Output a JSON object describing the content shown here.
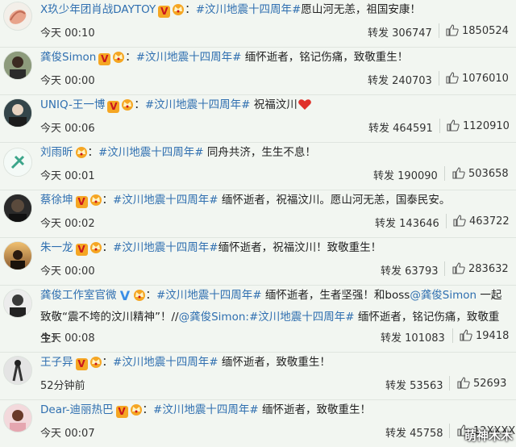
{
  "posts": [
    {
      "nick": "X玖少年团肖战DAYTOY",
      "badge": "V",
      "badge_type": "red",
      "crown": true,
      "sep": "：",
      "topic": "#汶川地震十四周年#",
      "text": "愿山河无恙，祖国安康！",
      "time": "今天 00:10",
      "repost_label": "转发",
      "reposts": "306747",
      "likes": "1850524",
      "avatar_icon": "avatar-shell-icon"
    },
    {
      "nick": "龚俊Simon",
      "badge": "V",
      "badge_type": "red",
      "crown": true,
      "sep": "：",
      "topic": "#汶川地震十四周年#",
      "text": " 缅怀逝者，铭记伤痛，致敬重生！",
      "time": "今天 00:00",
      "repost_label": "转发",
      "reposts": "240703",
      "likes": "1076010",
      "avatar_icon": "avatar-person-icon"
    },
    {
      "nick": "UNIQ-王一博",
      "badge": "V",
      "badge_type": "red",
      "crown": true,
      "sep": "：",
      "topic": "#汶川地震十四周年#",
      "text": " 祝福汶川",
      "time": "今天 00:06",
      "repost_label": "转发",
      "reposts": "464591",
      "likes": "1120910",
      "avatar_icon": "avatar-person-icon"
    },
    {
      "nick": "刘雨昕",
      "badge": "",
      "badge_type": "",
      "crown": true,
      "sep": "：",
      "topic": "#汶川地震十四周年#",
      "text": " 同舟共济，生生不息！",
      "time": "今天 00:01",
      "repost_label": "转发",
      "reposts": "190090",
      "likes": "503658",
      "avatar_icon": "avatar-logo-icon"
    },
    {
      "nick": "蔡徐坤",
      "badge": "V",
      "badge_type": "red",
      "crown": true,
      "sep": "：",
      "topic": "#汶川地震十四周年#",
      "text": " 缅怀逝者，祝福汶川。愿山河无恙，国泰民安。",
      "time": "今天 00:02",
      "repost_label": "转发",
      "reposts": "143646",
      "likes": "463722",
      "avatar_icon": "avatar-person-icon"
    },
    {
      "nick": "朱一龙",
      "badge": "V",
      "badge_type": "red",
      "crown": true,
      "sep": "：",
      "topic": "#汶川地震十四周年#",
      "text": "缅怀逝者，祝福汶川！致敬重生！",
      "time": "今天 00:00",
      "repost_label": "转发",
      "reposts": "63793",
      "likes": "283632",
      "avatar_icon": "avatar-sunset-icon"
    },
    {
      "nick": "龚俊工作室官微",
      "badge": "V",
      "badge_type": "blue",
      "crown": true,
      "sep": "：",
      "topic": "#汶川地震十四周年#",
      "text": " 缅怀逝者，生者坚强！和boss",
      "mention": "@龚俊Simon",
      "text2": " 一起致敬“震不垮的汶川精神”！//",
      "mention2": "@龚俊Simon",
      "text3": ":",
      "topic2": "#汶川地震十四周年#",
      "text4": " 缅怀逝者，铭记伤痛，致敬重生！",
      "time": "今天 00:08",
      "repost_label": "转发",
      "reposts": "101083",
      "likes": "19418",
      "avatar_icon": "avatar-person-icon"
    },
    {
      "nick": "王子异",
      "badge": "V",
      "badge_type": "red",
      "crown": true,
      "sep": "：",
      "topic": "#汶川地震十四周年#",
      "text": " 缅怀逝者，致敬重生！",
      "time": "52分钟前",
      "repost_label": "转发",
      "reposts": "53563",
      "likes": "52693",
      "avatar_icon": "avatar-person-icon"
    },
    {
      "nick": "Dear-迪丽热巴",
      "badge": "V",
      "badge_type": "red",
      "crown": true,
      "sep": "：",
      "topic": "#汶川地震十四周年#",
      "text": " 缅怀逝者，致敬重生！",
      "time": "今天 00:07",
      "repost_label": "转发",
      "reposts": "45758",
      "likes": "12XXXX",
      "avatar_icon": "avatar-person-icon"
    }
  ],
  "watermark": "萌神木木",
  "colors": {
    "link": "#2f6fb0",
    "badge_bg": "#f5a623",
    "badge_v": "#c9151e",
    "blue_v": "#3a8ee6",
    "heart": "#e0302a"
  }
}
